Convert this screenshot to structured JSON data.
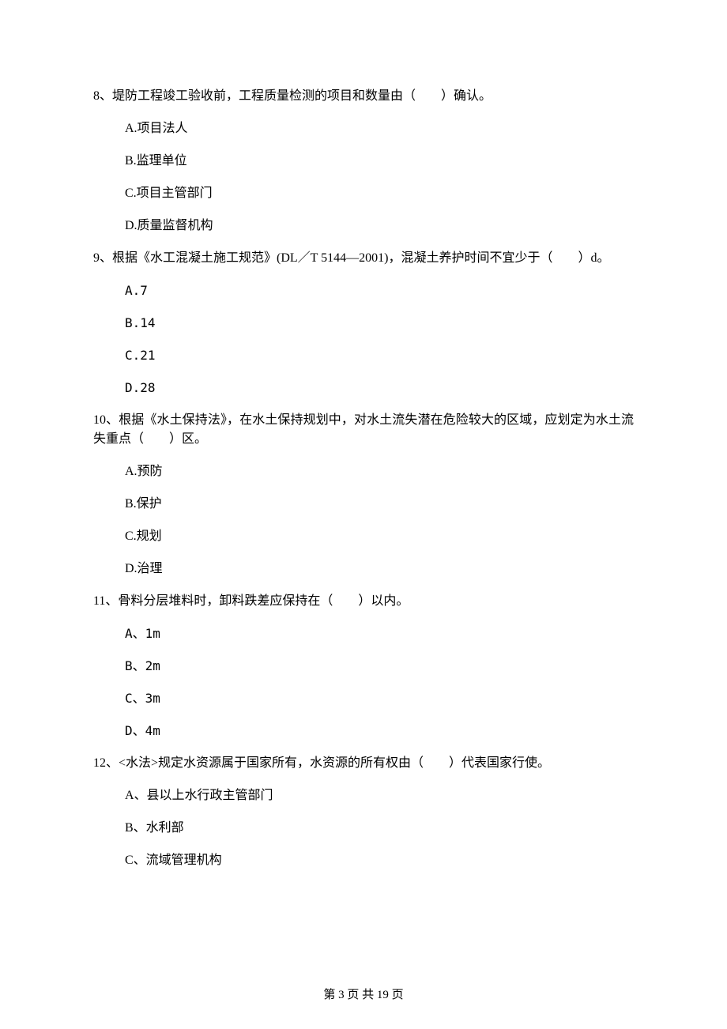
{
  "q8": {
    "stem": "8、堤防工程竣工验收前，工程质量检测的项目和数量由（　　）确认。",
    "opts": [
      "A.项目法人",
      "B.监理单位",
      "C.项目主管部门",
      "D.质量监督机构"
    ]
  },
  "q9": {
    "stem": "9、根据《水工混凝土施工规范》(DL／T 5144—2001)，混凝土养护时间不宜少于（　　）d。",
    "opts": [
      "A.7",
      "B.14",
      "C.21",
      "D.28"
    ]
  },
  "q10": {
    "stem": "10、根据《水土保持法》，在水土保持规划中，对水土流失潜在危险较大的区域，应划定为水土流失重点（　　）区。",
    "opts": [
      "A.预防",
      "B.保护",
      "C.规划",
      "D.治理"
    ]
  },
  "q11": {
    "stem": "11、骨料分层堆料时，卸料跌差应保持在（　　）以内。",
    "opts": [
      "A、1m",
      "B、2m",
      "C、3m",
      "D、4m"
    ]
  },
  "q12": {
    "stem": "12、<水法>规定水资源属于国家所有，水资源的所有权由（　　）代表国家行使。",
    "opts": [
      "A、县以上水行政主管部门",
      "B、水利部",
      "C、流域管理机构"
    ]
  },
  "footer": "第 3 页 共 19 页"
}
